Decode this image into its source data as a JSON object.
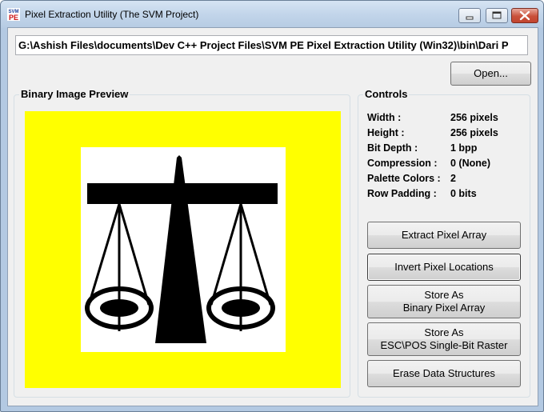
{
  "window": {
    "title": "Pixel Extraction Utility (The SVM Project)",
    "icon_text_top": "SVM",
    "icon_text_bottom": "PE"
  },
  "path": {
    "value": "G:\\Ashish Files\\documents\\Dev C++ Project Files\\SVM PE Pixel Extraction Utility (Win32)\\bin\\Dari P"
  },
  "buttons": {
    "open": "Open...",
    "extract": "Extract Pixel Array",
    "invert": "Invert Pixel Locations",
    "store_binary_line1": "Store As",
    "store_binary_line2": "Binary Pixel Array",
    "store_esc_line1": "Store As",
    "store_esc_line2": "ESC\\POS Single-Bit Raster",
    "erase": "Erase Data Structures"
  },
  "preview": {
    "label": "Binary Image Preview",
    "background_color": "#ffff00"
  },
  "controls": {
    "label": "Controls",
    "rows": [
      {
        "label": "Width :",
        "value": "256 pixels"
      },
      {
        "label": "Height :",
        "value": "256 pixels"
      },
      {
        "label": "Bit Depth :",
        "value": "1 bpp"
      },
      {
        "label": "Compression :",
        "value": "0 (None)"
      },
      {
        "label": "Palette Colors :",
        "value": "2"
      },
      {
        "label": "Row Padding :",
        "value": "0 bits"
      }
    ]
  },
  "icons": [
    "app-icon",
    "minimize-icon",
    "maximize-icon",
    "close-icon"
  ]
}
